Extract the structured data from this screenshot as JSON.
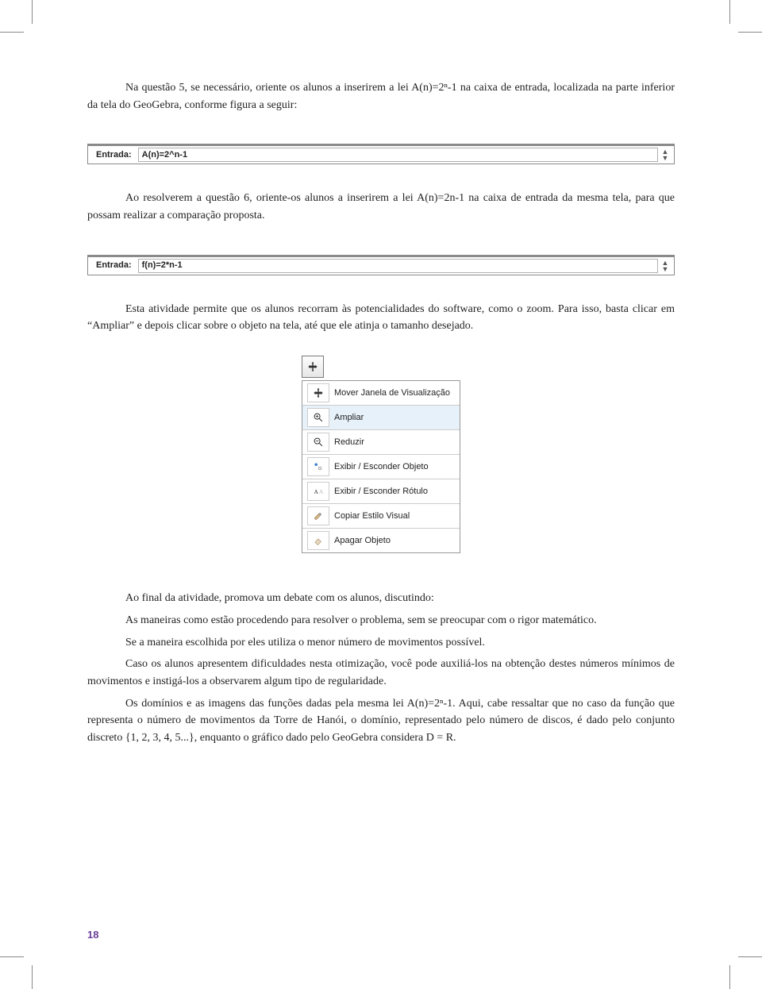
{
  "para1": "Na questão 5, se necessário, oriente os alunos a inserirem a lei A(n)=2ⁿ-1 na caixa de entrada, localizada na parte inferior da tela do GeoGebra, conforme figura a seguir:",
  "input1": {
    "label": "Entrada:",
    "value": "A(n)=2^n-1"
  },
  "para2": "Ao resolverem a questão 6, oriente-os alunos a inserirem a lei A(n)=2n-1 na caixa de entrada da mesma tela, para que possam realizar a comparação proposta.",
  "input2": {
    "label": "Entrada:",
    "value": "f(n)=2*n-1"
  },
  "para3": "Esta atividade permite que os alunos recorram às potencialidades do software, como o zoom. Para isso, basta clicar em “Ampliar” e depois clicar sobre o objeto na tela, até que ele atinja o tamanho desejado.",
  "menu": {
    "items": [
      {
        "label": "Mover Janela de Visualização",
        "icon": "move",
        "selected": false
      },
      {
        "label": "Ampliar",
        "icon": "zoom-in",
        "selected": true
      },
      {
        "label": "Reduzir",
        "icon": "zoom-out",
        "selected": false
      },
      {
        "label": "Exibir / Esconder Objeto",
        "icon": "show-object",
        "selected": false
      },
      {
        "label": "Exibir / Esconder Rótulo",
        "icon": "show-label",
        "selected": false
      },
      {
        "label": "Copiar Estilo Visual",
        "icon": "copy-style",
        "selected": false
      },
      {
        "label": "Apagar Objeto",
        "icon": "erase",
        "selected": false
      }
    ]
  },
  "para4": "Ao final da atividade, promova um debate com os alunos, discutindo:",
  "para5": "As maneiras como estão procedendo para resolver o problema, sem se preocupar com o rigor matemático.",
  "para6": "Se a maneira escolhida por eles utiliza o menor número de movimentos possível.",
  "para7": "Caso os alunos apresentem dificuldades nesta otimização, você pode auxiliá-los na obtenção destes números mínimos de movimentos e instigá-los a observarem algum tipo de regularidade.",
  "para8": "Os domínios e as imagens das funções dadas pela mesma lei A(n)=2ⁿ-1. Aqui, cabe ressaltar que no caso da função que representa o número de movimentos da Torre de Hanói, o domínio, representado pelo número de discos, é dado pelo conjunto discreto {1, 2, 3, 4, 5...}, enquanto o gráfico dado pelo GeoGebra considera D = R.",
  "page_number": "18"
}
